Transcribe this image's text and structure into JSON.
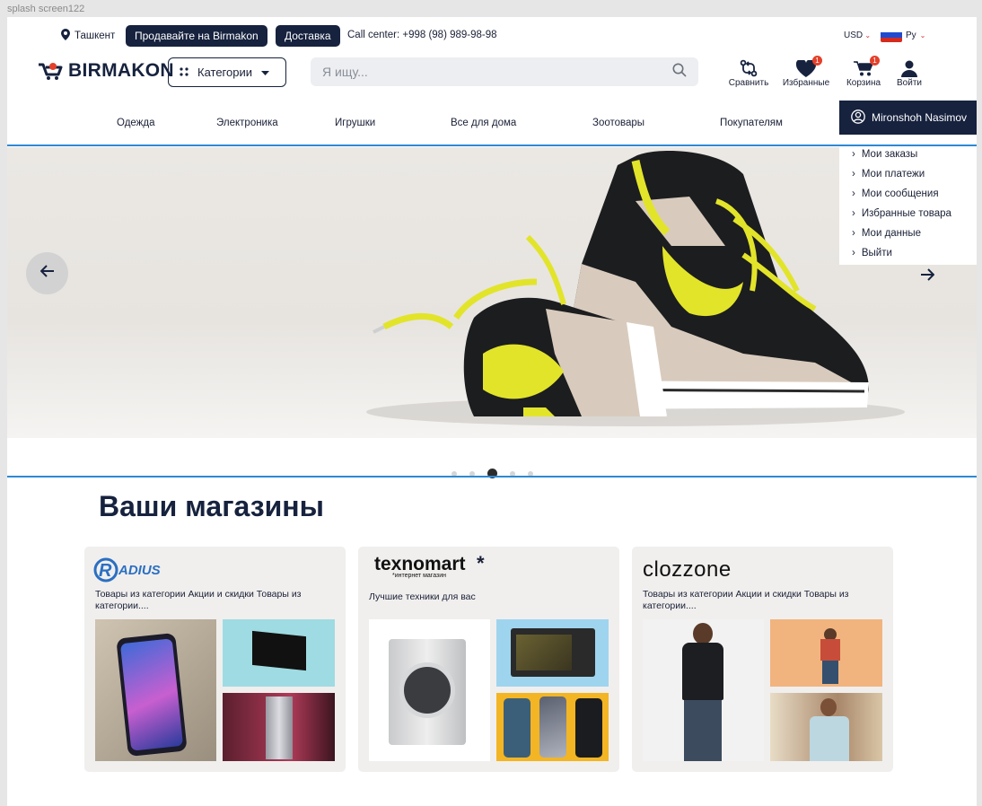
{
  "frame_label": "splash screen122",
  "topbar": {
    "location": "Ташкент",
    "sell_button": "Продавайте на Birmakon",
    "delivery_button": "Доставка",
    "call_center": "Call center: +998 (98) 989-98-98",
    "currency": "USD",
    "language": "Ру"
  },
  "header": {
    "logo": "BIRMAKON",
    "categories_button": "Категории",
    "search_placeholder": "Я ищу...",
    "icons": [
      {
        "label": "Сравнить",
        "icon": "compare-icon"
      },
      {
        "label": "Избранные",
        "icon": "heart-icon",
        "badge": "1"
      },
      {
        "label": "Корзина",
        "icon": "cart-icon",
        "badge": "1"
      },
      {
        "label": "Войти",
        "icon": "user-icon"
      }
    ]
  },
  "nav": {
    "items": [
      "Одежда",
      "Электроника",
      "Игрушки",
      "Все для дома",
      "Зоотовары",
      "Покупателям"
    ],
    "user_name": "Mironshoh Nasimov",
    "user_menu": [
      "Мои заказы",
      "Мои платежи",
      "Мои сообщения",
      "Избранные товара",
      "Мои данные",
      "Выйти"
    ]
  },
  "slider": {
    "dot_count": 5,
    "active_dot": 3,
    "colors": {
      "shoe_black": "#1c1d1f",
      "shoe_yellow": "#e2e42a",
      "shoe_beige": "#d8cbbd"
    }
  },
  "stores": {
    "title": "Ваши магазины",
    "cards": [
      {
        "brand": "RADIUS",
        "description": "Товары из категории Акции и скидки Товары из категории...."
      },
      {
        "brand": "texnomart",
        "brand_sub": "*интернет магазин",
        "description": "Лучшие техники для вас"
      },
      {
        "brand": "clozzone",
        "description": "Товары из категории Акции и скидки Товары из категории...."
      }
    ]
  },
  "colors": {
    "navy": "#16223e",
    "accent_blue": "#2c8ad6",
    "badge_red": "#e4402a",
    "logo_red": "#e4402a"
  }
}
